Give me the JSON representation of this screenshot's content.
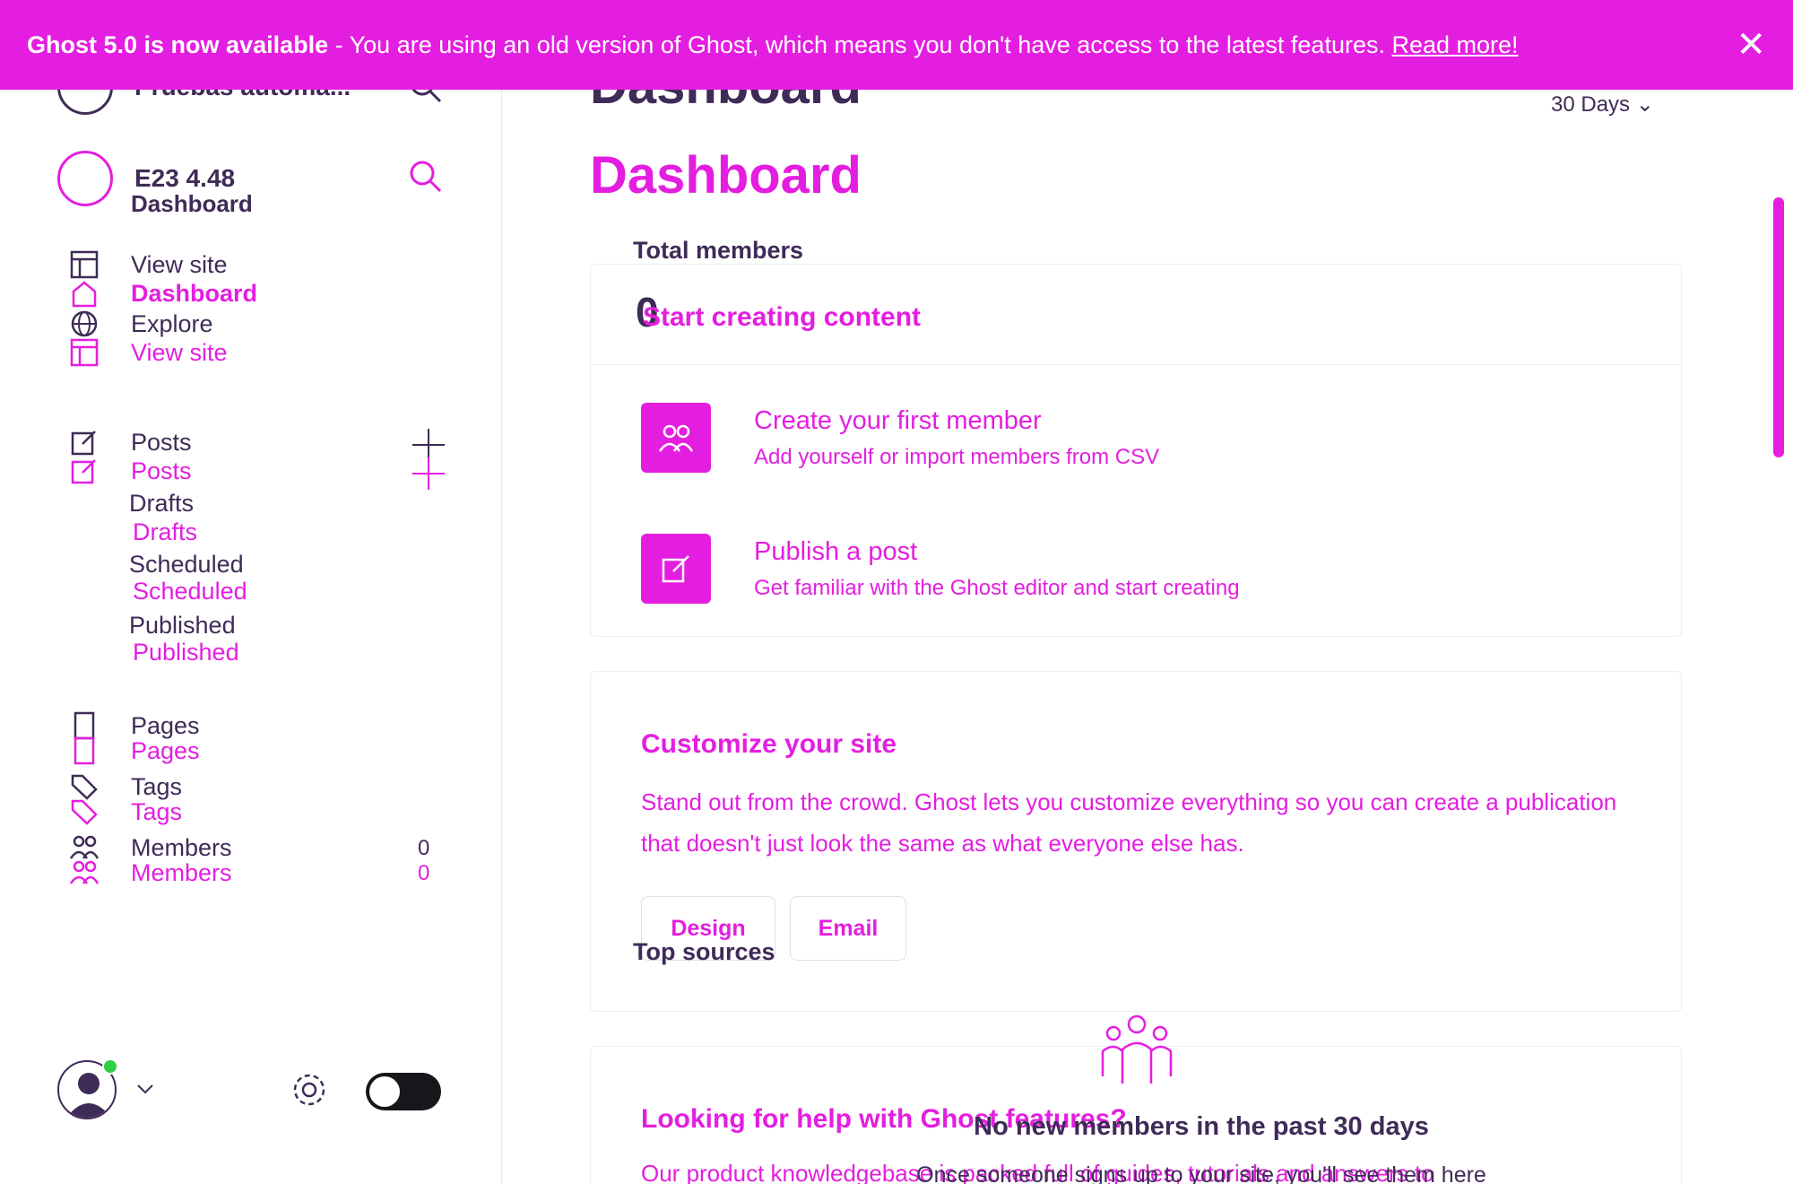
{
  "colors": {
    "accent": "#e41ee0",
    "text": "#3f2b57",
    "online": "#30cf43"
  },
  "banner": {
    "headline": "Ghost 5.0 is now available",
    "message": " - You are using an old version of Ghost, which means you don't have access to the latest features. ",
    "link": "Read more!",
    "close_icon": "close-icon"
  },
  "sidebar": {
    "site_name": "Pruebas automa...",
    "site_version": "E23 4.48",
    "site_sub": "Dashboard",
    "nav": {
      "view_site": "View site",
      "dashboard": "Dashboard",
      "explore": "Explore",
      "view_site_2": "View site",
      "posts": "Posts",
      "posts_2": "Posts",
      "drafts": "Drafts",
      "drafts_2": "Drafts",
      "scheduled": "Scheduled",
      "scheduled_2": "Scheduled",
      "published": "Published",
      "published_2": "Published",
      "pages": "Pages",
      "pages_2": "Pages",
      "tags": "Tags",
      "tags_2": "Tags",
      "members": "Members",
      "members_2": "Members",
      "members_count": "0",
      "members_count_2": "0"
    }
  },
  "main": {
    "title_shadow": "Dashboard",
    "title": "Dashboard",
    "range": "30 Days",
    "total_members_label": "Total members",
    "total_members_value": "0",
    "start": {
      "title": "Start creating content",
      "member_title": "Create your first member",
      "member_desc": "Add yourself or import members from CSV",
      "post_title": "Publish a post",
      "post_desc": "Get familiar with the Ghost editor and start creating"
    },
    "customize": {
      "title": "Customize your site",
      "body": "Stand out from the crowd. Ghost lets you customize everything so you can create a publication that doesn't just look the same as what everyone else has.",
      "design_button": "Design",
      "email_button": "Email"
    },
    "top_sources_label": "Top sources",
    "help": {
      "title": "Looking for help with Ghost features?",
      "body": "Our product knowledgebase is packed full of guides, tutorials and answers to"
    },
    "empty_members": {
      "title": "No new members in the past 30 days",
      "copy": "Once someone signs up to your site, you'll see them here"
    }
  }
}
